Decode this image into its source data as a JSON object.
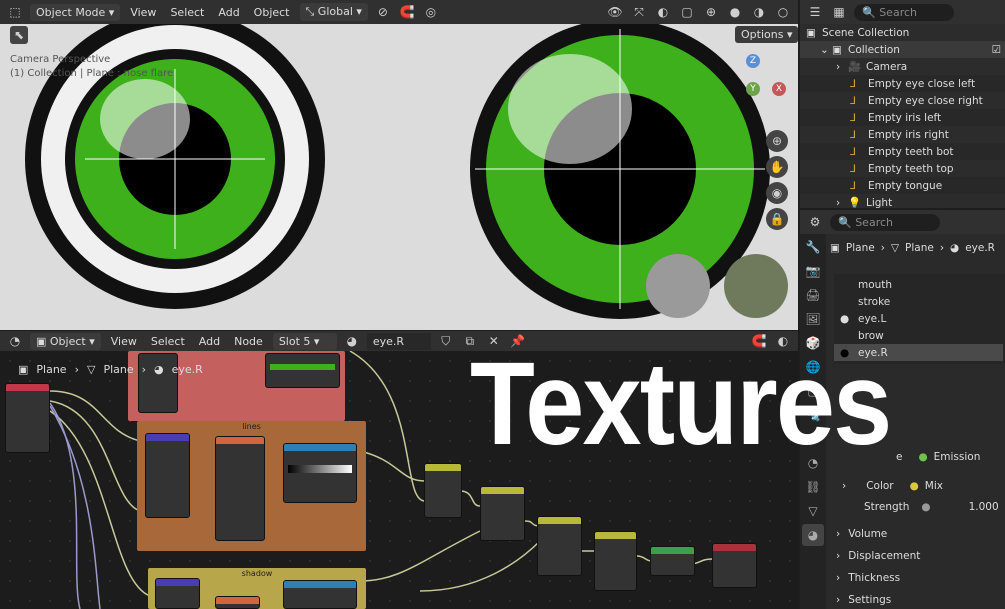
{
  "viewport": {
    "mode": "Object Mode",
    "menus": [
      "View",
      "Select",
      "Add",
      "Object"
    ],
    "transform_orientation": "Global",
    "options_label": "Options",
    "camera_label": "Camera Perspective",
    "object_label": "(1) Collection | Plane : nose flare",
    "gizmo_axes": [
      "Z",
      "Y",
      "X"
    ]
  },
  "outliner": {
    "search_placeholder": "Search",
    "rows": [
      "Scene Collection",
      "Collection",
      "Camera",
      "Empty eye close left",
      "Empty eye close right",
      "Empty iris left",
      "Empty iris right",
      "Empty teeth bot",
      "Empty teeth top",
      "Empty tongue",
      "Light"
    ]
  },
  "properties": {
    "search_placeholder": "Search",
    "breadcrumb": [
      "Plane",
      "Plane",
      "eye.R"
    ],
    "slots": [
      "mouth",
      "stroke",
      "eye.L",
      "brow",
      "eye.R"
    ],
    "surface": {
      "shader_label": "e",
      "shader_value": "Emission",
      "color_label": "Color",
      "color_value": "Mix",
      "strength_label": "Strength",
      "strength_value": "1.000"
    },
    "sections": [
      "Volume",
      "Displacement",
      "Thickness",
      "Settings"
    ]
  },
  "node_editor": {
    "type": "Object",
    "menus": [
      "View",
      "Select",
      "Add",
      "Node"
    ],
    "slot": "Slot 5",
    "material": "eye.R",
    "breadcrumb": [
      "Plane",
      "Plane",
      "eye.R"
    ],
    "frames": [
      "lines",
      "shadow"
    ]
  },
  "overlay_title": "Textures",
  "colors": {
    "iris_green": "#3db01c",
    "frame_red": "#c4605e",
    "frame_orange": "#a8683a",
    "frame_yellow": "#b8a64a"
  }
}
